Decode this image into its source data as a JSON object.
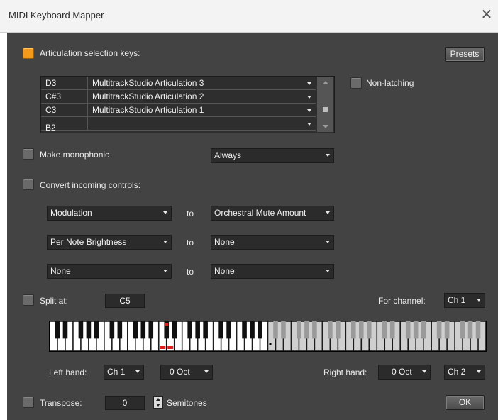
{
  "window": {
    "title": "MIDI Keyboard Mapper",
    "close_glyph": "✕"
  },
  "articulation": {
    "label": "Articulation selection keys:",
    "checked": true,
    "presets_label": "Presets",
    "rows": [
      {
        "key": "D3",
        "name": "MultitrackStudio Articulation 3"
      },
      {
        "key": "C#3",
        "name": "MultitrackStudio Articulation 2"
      },
      {
        "key": "C3",
        "name": "MultitrackStudio Articulation 1"
      },
      {
        "key": "B2",
        "name": ""
      }
    ],
    "non_latching_label": "Non-latching",
    "non_latching_checked": false
  },
  "monophonic": {
    "label": "Make monophonic",
    "checked": false,
    "mode": "Always"
  },
  "convert": {
    "label": "Convert incoming controls:",
    "checked": false,
    "to_label": "to",
    "rows": [
      {
        "from": "Modulation",
        "to": "Orchestral Mute Amount"
      },
      {
        "from": "Per Note Brightness",
        "to": "None"
      },
      {
        "from": "None",
        "to": "None"
      }
    ]
  },
  "split": {
    "label": "Split at:",
    "checked": false,
    "note": "C5",
    "for_channel_label": "For channel:",
    "channel": "Ch 1"
  },
  "hands": {
    "left_label": "Left hand:",
    "left_channel": "Ch 1",
    "left_octave": "0 Oct",
    "right_label": "Right hand:",
    "right_octave": "0 Oct",
    "right_channel": "Ch 2"
  },
  "transpose": {
    "label": "Transpose:",
    "checked": false,
    "value": "0",
    "unit_label": "Semitones"
  },
  "ok_label": "OK",
  "keyboard": {
    "octaves": 8,
    "split_octave_index": 4,
    "highlight_octave_index": 2,
    "highlighted_keys": [
      "C3",
      "C#3",
      "D3"
    ],
    "colors": {
      "white_left": "#ffffff",
      "white_right": "#cfcfcf",
      "black_left": "#101010",
      "black_right": "#9a9a9a",
      "highlight": "#e02020"
    }
  },
  "colors": {
    "accent": "#f49a1a",
    "panel": "#434343"
  }
}
